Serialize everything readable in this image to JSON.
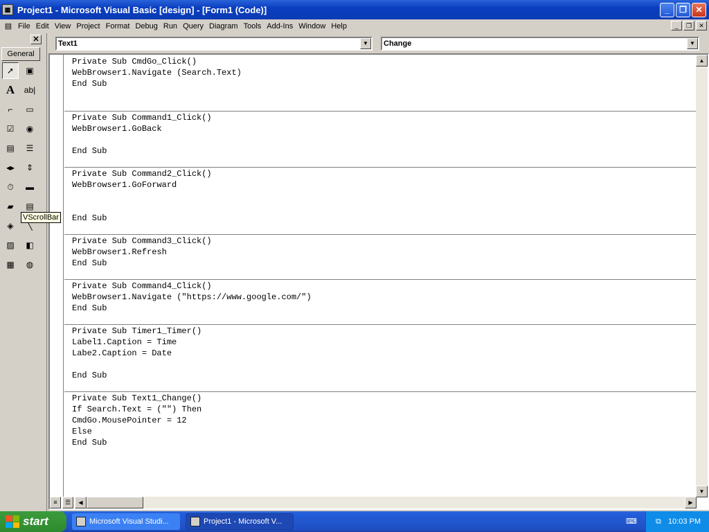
{
  "window": {
    "title": "Project1 - Microsoft Visual Basic [design] - [Form1 (Code)]"
  },
  "menu": [
    "File",
    "Edit",
    "View",
    "Project",
    "Format",
    "Debug",
    "Run",
    "Query",
    "Diagram",
    "Tools",
    "Add-Ins",
    "Window",
    "Help"
  ],
  "toolbox": {
    "tab": "General",
    "tooltip": "VScrollBar",
    "tools": [
      "pointer-icon",
      "picturebox-icon",
      "label-icon",
      "textbox-icon",
      "frame-icon",
      "commandbutton-icon",
      "checkbox-icon",
      "optionbutton-icon",
      "combobox-icon",
      "listbox-icon",
      "hscrollbar-icon",
      "vscrollbar-icon",
      "timer-icon",
      "drivelistbox-icon",
      "dirlistbox-icon",
      "filelistbox-icon",
      "shape-icon",
      "line-icon",
      "image-icon",
      "data-icon",
      "ole-icon",
      "webbrowser-icon"
    ]
  },
  "code_window": {
    "object_combo": "Text1",
    "procedure_combo": "Change",
    "procedures": [
      [
        "Private Sub CmdGo_Click()",
        "WebBrowser1.Navigate (Search.Text)",
        "End Sub",
        "",
        ""
      ],
      [
        "Private Sub Command1_Click()",
        "WebBrowser1.GoBack",
        "",
        "End Sub",
        ""
      ],
      [
        "Private Sub Command2_Click()",
        "WebBrowser1.GoForward",
        "",
        "",
        "End Sub",
        ""
      ],
      [
        "Private Sub Command3_Click()",
        "WebBrowser1.Refresh",
        "End Sub",
        ""
      ],
      [
        "Private Sub Command4_Click()",
        "WebBrowser1.Navigate (\"https://www.google.com/\")",
        "End Sub",
        ""
      ],
      [
        "Private Sub Timer1_Timer()",
        "Label1.Caption = Time",
        "Labe2.Caption = Date",
        "",
        "End Sub",
        ""
      ],
      [
        "Private Sub Text1_Change()",
        "If Search.Text = (\"\") Then",
        "CmdGo.MousePointer = 12",
        "Else",
        "End Sub"
      ]
    ]
  },
  "taskbar": {
    "start": "start",
    "tasks": [
      {
        "label": "Microsoft Visual Studi...",
        "active": false
      },
      {
        "label": "Project1 - Microsoft V...",
        "active": true
      }
    ],
    "clock": "10:03 PM"
  },
  "colors": {
    "title_bar": "#0a3ec0",
    "taskbar": "#245edb",
    "start": "#3c9b3c",
    "tray": "#0f8ce8"
  }
}
